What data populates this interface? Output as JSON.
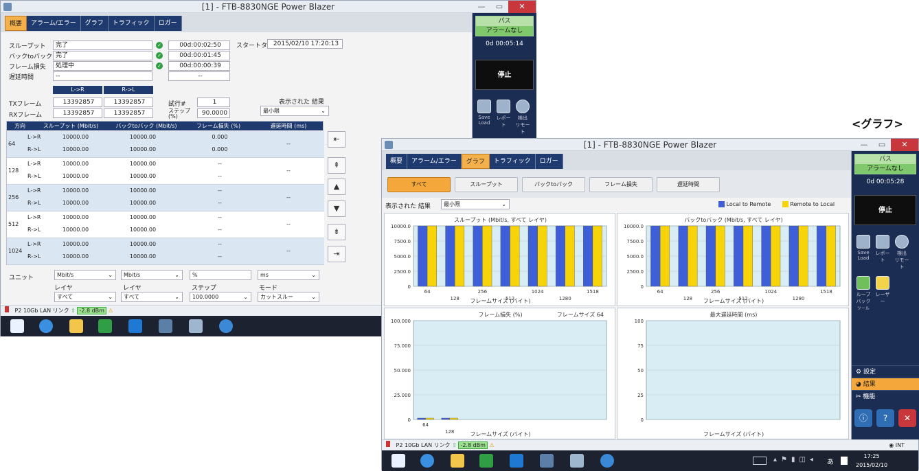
{
  "heading": "<グラフ>",
  "win1": {
    "title": "[1] - FTB-8830NGE Power Blazer",
    "tabs": [
      "概要",
      "アラーム/エラー",
      "グラフ",
      "トラフィック",
      "ロガー"
    ],
    "tests": [
      {
        "label": "スループット",
        "status": "完了",
        "time": "00d:00:02:50"
      },
      {
        "label": "バックtoバック",
        "status": "完了",
        "time": "00d:00:01:45"
      },
      {
        "label": "フレーム損失",
        "status": "処理中",
        "time": "00d:00:00:39"
      },
      {
        "label": "遅延時間",
        "status": "--",
        "time": "--"
      }
    ],
    "start_time_label": "スタートタイ",
    "start_time": "2015/02/10 17:20:13",
    "dir_headers": [
      "L->R",
      "R->L"
    ],
    "tx_label": "TXフレーム",
    "rx_label": "RXフレーム",
    "tx": [
      "13392857",
      "13392857"
    ],
    "rx": [
      "13392857",
      "13392857"
    ],
    "trial_label": "試行#",
    "trial": "1",
    "step_label": "ステップ (%)",
    "step": "90.0000",
    "result_label": "表示された 結果",
    "result_value": "最小限",
    "table_headers": [
      "方向",
      "スループット (Mbit/s)",
      "バックtoバック (Mbit/s)",
      "フレーム損失 (%)",
      "遅延時間 (ms)"
    ],
    "rows": [
      {
        "size": "64",
        "lines": [
          [
            "L->R",
            "10000.00",
            "10000.00",
            "0.000"
          ],
          [
            "R->L",
            "10000.00",
            "10000.00",
            "0.000"
          ]
        ],
        "latency": "--"
      },
      {
        "size": "128",
        "lines": [
          [
            "L->R",
            "10000.00",
            "10000.00",
            "--"
          ],
          [
            "R->L",
            "10000.00",
            "10000.00",
            "--"
          ]
        ],
        "latency": "--"
      },
      {
        "size": "256",
        "lines": [
          [
            "L->R",
            "10000.00",
            "10000.00",
            "--"
          ],
          [
            "R->L",
            "10000.00",
            "10000.00",
            "--"
          ]
        ],
        "latency": "--"
      },
      {
        "size": "512",
        "lines": [
          [
            "L->R",
            "10000.00",
            "10000.00",
            "--"
          ],
          [
            "R->L",
            "10000.00",
            "10000.00",
            "--"
          ]
        ],
        "latency": "--"
      },
      {
        "size": "1024",
        "lines": [
          [
            "L->R",
            "10000.00",
            "10000.00",
            "--"
          ],
          [
            "R->L",
            "10000.00",
            "10000.00",
            "--"
          ]
        ],
        "latency": "--"
      }
    ],
    "units_label": "ユニット",
    "units": [
      "Mbit/s",
      "Mbit/s",
      "%",
      "ms"
    ],
    "layer_label": "レイヤ",
    "layer1": "すべて",
    "layer2": "すべて",
    "step2_label": "ステップ",
    "step2": "100.0000",
    "mode_label": "モード",
    "mode": "カットスルー",
    "status": "P2 10Gb LAN リンク",
    "dbm": "-2.8 dBm",
    "pass": "パス",
    "alarm": "アラームなし",
    "elapsed": "0d 00:05:14",
    "stop": "停止",
    "side_icons": [
      "Save Load",
      "レポート",
      "検出 リモート"
    ]
  },
  "win2": {
    "title": "[1] - FTB-8830NGE Power Blazer",
    "tabs": [
      "概要",
      "アラーム/エラー",
      "グラフ",
      "トラフィック",
      "ロガー"
    ],
    "filters": [
      "すべて",
      "スループット",
      "バックtoバック",
      "フレーム損失",
      "遅延時間"
    ],
    "result_label": "表示された 結果",
    "result_value": "最小限",
    "legend": [
      "Local to Remote",
      "Remote to Local"
    ],
    "pass": "パス",
    "alarm": "アラームなし",
    "elapsed": "0d 00:05:28",
    "stop": "停止",
    "side_icons": [
      "Save Load",
      "レポート",
      "検出 リモート",
      "ループ バック",
      "レーザー"
    ],
    "loopback_sub": "ツール",
    "menu": [
      "設定",
      "結果",
      "機能"
    ],
    "status": "P2 10Gb LAN リンク",
    "dbm": "-2.8 dBm",
    "int_label": "INT",
    "clock_time": "17:25",
    "clock_date": "2015/02/10",
    "ime": "あ"
  },
  "chart_data": [
    {
      "type": "bar",
      "title": "スループット (Mbit/s, すべて レイヤ)",
      "xlabel": "フレームサイズ (バイト)",
      "ylabel": "",
      "categories": [
        "64",
        "128",
        "256",
        "512",
        "1024",
        "1280",
        "1518"
      ],
      "series": [
        {
          "name": "Local to Remote",
          "values": [
            10000,
            10000,
            10000,
            10000,
            10000,
            10000,
            10000
          ]
        },
        {
          "name": "Remote to Local",
          "values": [
            10000,
            10000,
            10000,
            10000,
            10000,
            10000,
            10000
          ]
        }
      ],
      "ylim": [
        0,
        10000
      ],
      "yticks": [
        "0",
        "2500.0",
        "5000.0",
        "7500.0",
        "10000.0"
      ]
    },
    {
      "type": "bar",
      "title": "バックtoバック (Mbit/s, すべて レイヤ)",
      "xlabel": "フレームサイズ (バイト)",
      "ylabel": "",
      "categories": [
        "64",
        "128",
        "256",
        "512",
        "1024",
        "1280",
        "1518"
      ],
      "series": [
        {
          "name": "Local to Remote",
          "values": [
            10000,
            10000,
            10000,
            10000,
            10000,
            10000,
            10000
          ]
        },
        {
          "name": "Remote to Local",
          "values": [
            10000,
            10000,
            10000,
            10000,
            10000,
            10000,
            10000
          ]
        }
      ],
      "ylim": [
        0,
        10000
      ],
      "yticks": [
        "0",
        "2500.0",
        "5000.0",
        "7500.0",
        "10000.0"
      ]
    },
    {
      "type": "bar",
      "title": "フレーム損失 (%)",
      "subtitle": "フレームサイズ 64",
      "xlabel": "フレームサイズ (バイト)",
      "ylabel": "",
      "categories": [
        "64",
        "128"
      ],
      "series": [
        {
          "name": "Local to Remote",
          "values": [
            0,
            0
          ]
        },
        {
          "name": "Remote to Local",
          "values": [
            0,
            0
          ]
        }
      ],
      "ylim": [
        0,
        100
      ],
      "yticks": [
        "0",
        "25.000",
        "50.000",
        "75.000",
        "100.000"
      ]
    },
    {
      "type": "bar",
      "title": "最大遅延時間 (ms)",
      "xlabel": "フレームサイズ (バイト)",
      "ylabel": "",
      "categories": [],
      "series": [],
      "ylim": [
        0,
        100
      ],
      "yticks": [
        "0",
        "25",
        "50",
        "75",
        "100"
      ]
    }
  ]
}
